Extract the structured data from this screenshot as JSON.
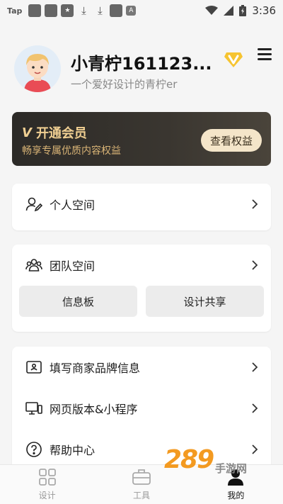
{
  "status_bar": {
    "app_label": "Tap",
    "time": "3:36"
  },
  "profile": {
    "username": "小青柠161123...",
    "bio": "一个爱好设计的青柠er"
  },
  "vip": {
    "title": "开通会员",
    "subtitle": "畅享专属优质内容权益",
    "button": "查看权益",
    "accent": "#f0cf92"
  },
  "personal": {
    "label": "个人空间"
  },
  "team": {
    "label": "团队空间",
    "buttons": [
      "信息板",
      "设计共享"
    ]
  },
  "menu": [
    {
      "label": "填写商家品牌信息",
      "icon": "id-card-icon"
    },
    {
      "label": "网页版本&小程序",
      "icon": "monitor-icon"
    },
    {
      "label": "帮助中心",
      "icon": "help-icon"
    }
  ],
  "bottom_nav": [
    {
      "label": "设计",
      "icon": "grid-icon",
      "active": false
    },
    {
      "label": "工具",
      "icon": "toolbox-icon",
      "active": false
    },
    {
      "label": "我的",
      "icon": "user-icon",
      "active": true
    }
  ],
  "watermark": {
    "main": "289",
    "sub": "手游网"
  }
}
